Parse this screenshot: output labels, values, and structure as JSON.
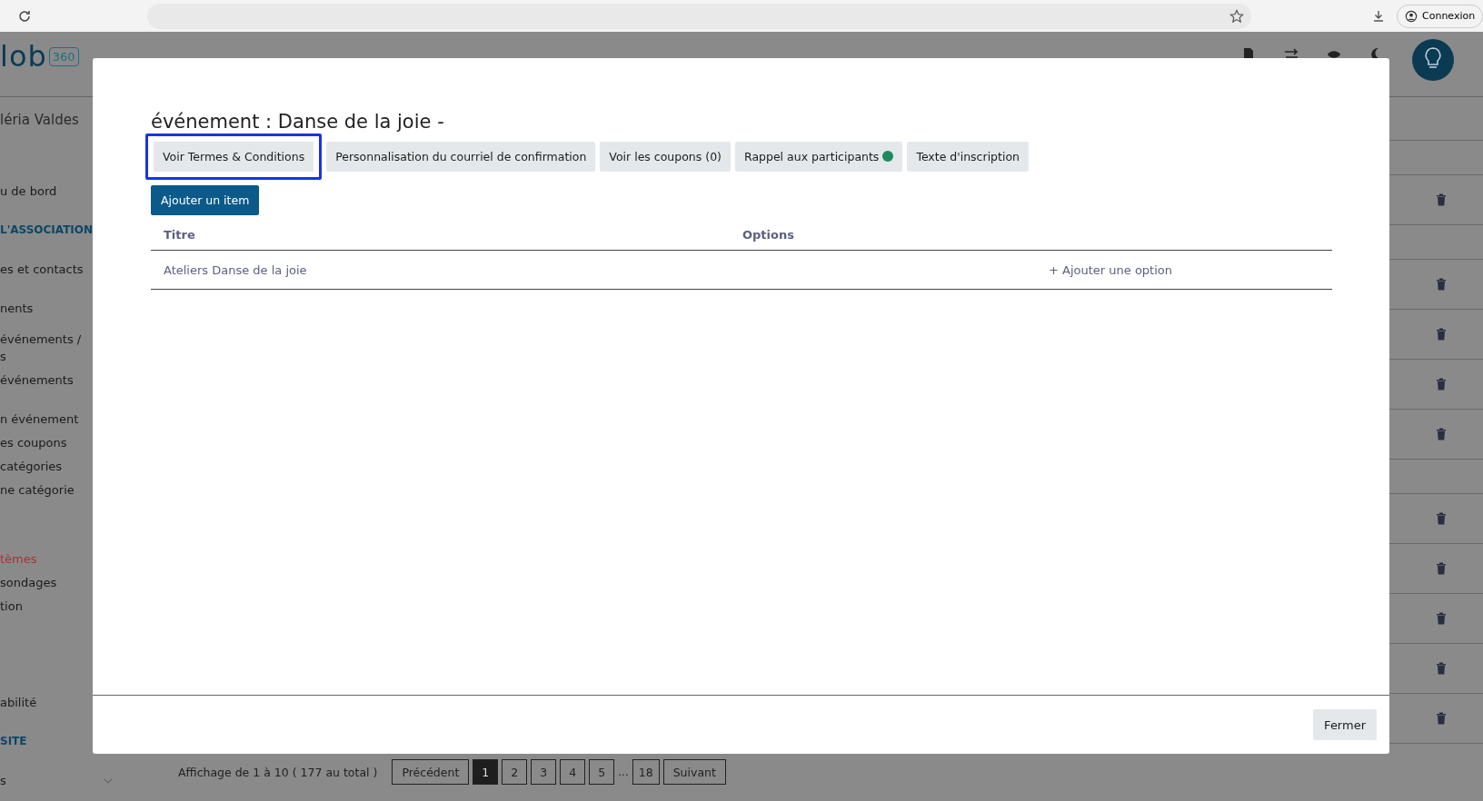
{
  "browser": {
    "account_button": "Connexion"
  },
  "header": {
    "logo": "lob",
    "logo_badge": "360"
  },
  "sidebar": {
    "items": [
      {
        "label": "léria Valdes",
        "kind": "user"
      },
      {
        "label": "u de bord",
        "kind": "link"
      },
      {
        "label": "L'ASSOCIATION",
        "kind": "section"
      },
      {
        "label": "es et contacts",
        "kind": "link"
      },
      {
        "label": "nents",
        "kind": "link"
      },
      {
        "label": "événements /\ns",
        "kind": "subhead"
      },
      {
        "label": "événements",
        "kind": "sub"
      },
      {
        "label": "n événement",
        "kind": "link"
      },
      {
        "label": "es coupons",
        "kind": "sub"
      },
      {
        "label": "catégories",
        "kind": "sub"
      },
      {
        "label": "ne catégorie",
        "kind": "sub"
      },
      {
        "label": "tèmes",
        "kind": "alert"
      },
      {
        "label": "sondages",
        "kind": "sub"
      },
      {
        "label": "tion",
        "kind": "sub"
      },
      {
        "label": "abilité",
        "kind": "gap"
      },
      {
        "label": "SITE",
        "kind": "section"
      },
      {
        "label": "s",
        "kind": "expand"
      }
    ]
  },
  "background_rows": [
    {
      "kind": "band"
    },
    {
      "kind": "item"
    },
    {
      "kind": "band"
    },
    {
      "kind": "item"
    },
    {
      "kind": "item"
    },
    {
      "kind": "item"
    },
    {
      "kind": "item"
    },
    {
      "kind": "band"
    },
    {
      "kind": "item"
    },
    {
      "kind": "item"
    },
    {
      "kind": "item"
    },
    {
      "kind": "item"
    },
    {
      "kind": "item"
    }
  ],
  "pagination": {
    "summary": "Affichage de 1 à 10 ( 177 au total )",
    "previous": "Précédent",
    "next": "Suivant",
    "ellipsis": "...",
    "pages": [
      {
        "label": "1",
        "selected": true
      },
      {
        "label": "2",
        "selected": false
      },
      {
        "label": "3",
        "selected": false
      },
      {
        "label": "4",
        "selected": false
      },
      {
        "label": "5",
        "selected": false
      },
      {
        "label": "18",
        "selected": false,
        "after_gap": true
      }
    ]
  },
  "modal": {
    "title": "événement : Danse de la joie -",
    "tabs": [
      {
        "label": "Voir Termes & Conditions",
        "selected": true,
        "indicator": false
      },
      {
        "label": "Personnalisation du courriel de confirmation",
        "selected": false,
        "indicator": false
      },
      {
        "label": "Voir les coupons (0)",
        "selected": false,
        "indicator": false
      },
      {
        "label": "Rappel aux participants",
        "selected": false,
        "indicator": true
      },
      {
        "label": "Texte d'inscription",
        "selected": false,
        "indicator": false
      }
    ],
    "add_button": "Ajouter un item",
    "table": {
      "columns": [
        "Titre",
        "Options"
      ],
      "rows": [
        {
          "title": "Ateliers Danse de la joie",
          "action": "+ Ajouter une option"
        }
      ]
    },
    "close_button": "Fermer"
  }
}
